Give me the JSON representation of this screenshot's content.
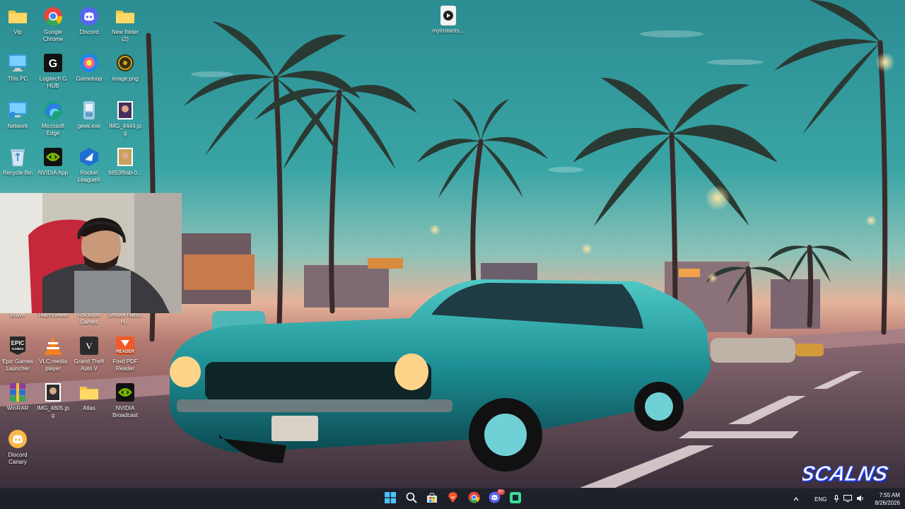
{
  "desktop": {
    "top_file": {
      "label": "myinstants...",
      "icon": "media-file-icon"
    },
    "icons": [
      {
        "id": "vip",
        "label": "Vip",
        "icon": "folder-icon",
        "color": "#f5c542"
      },
      {
        "id": "chrome",
        "label": "Google Chrome",
        "icon": "chrome-icon",
        "color": "#e8453c"
      },
      {
        "id": "discord",
        "label": "Discord",
        "icon": "discord-icon",
        "color": "#5865f2"
      },
      {
        "id": "new-folder",
        "label": "New folder (2)",
        "icon": "folder-icon",
        "color": "#f5c542"
      },
      {
        "id": "this-pc",
        "label": "This PC",
        "icon": "monitor-icon",
        "color": "#3aa0e8"
      },
      {
        "id": "logitech",
        "label": "Logitech G HUB",
        "icon": "logitech-icon",
        "color": "#111111"
      },
      {
        "id": "gameloop",
        "label": "Gameloop",
        "icon": "gameloop-icon",
        "color": "#1e88e5"
      },
      {
        "id": "image-png",
        "label": "image.png",
        "icon": "image-file-icon",
        "color": "#c9a227"
      },
      {
        "id": "network",
        "label": "Network",
        "icon": "network-icon",
        "color": "#3aa0e8"
      },
      {
        "id": "edge",
        "label": "Microsoft Edge",
        "icon": "edge-icon",
        "color": "#1aa37a"
      },
      {
        "id": "geek",
        "label": "geek.exe",
        "icon": "geek-icon",
        "color": "#7ab4d8"
      },
      {
        "id": "img4444",
        "label": "IMG_4444.jpg",
        "icon": "photo-thumbnail-icon",
        "color": "#4a2f5e"
      },
      {
        "id": "recycle",
        "label": "Recycle Bin",
        "icon": "recycle-bin-icon",
        "color": "#9fc7e0"
      },
      {
        "id": "nvidia-app",
        "label": "NVIDIA App",
        "icon": "nvidia-icon",
        "color": "#76b900"
      },
      {
        "id": "rocket",
        "label": "Rocket League®",
        "icon": "rocket-league-icon",
        "color": "#1f6fd1"
      },
      {
        "id": "b853",
        "label": "b853f6ab-0...",
        "icon": "photo-thumbnail-icon",
        "color": "#c6a15b"
      },
      {
        "id": "brave",
        "label": "Brave",
        "icon": "brave-icon",
        "color": "#fb542b"
      },
      {
        "id": "teamviewer",
        "label": "TeamViewer",
        "icon": "teamviewer-icon",
        "color": "#0e8ee9"
      },
      {
        "id": "rockstar",
        "label": "Rockstar Games",
        "icon": "rockstar-icon",
        "color": "#f4a900"
      },
      {
        "id": "smoke",
        "label": "Smoke Hand-H...",
        "icon": "photo-thumbnail-icon",
        "color": "#555555"
      },
      {
        "id": "epic",
        "label": "Epic Games Launcher",
        "icon": "epic-games-icon",
        "color": "#2a2a2a"
      },
      {
        "id": "vlc",
        "label": "VLC media player",
        "icon": "vlc-icon",
        "color": "#f58220"
      },
      {
        "id": "gta",
        "label": "Grand Theft Auto V",
        "icon": "gta-icon",
        "color": "#2b2b2b"
      },
      {
        "id": "foxit",
        "label": "Foxit PDF Reader",
        "icon": "foxit-icon",
        "color": "#f05a28"
      },
      {
        "id": "winrar",
        "label": "WinRAR",
        "icon": "winrar-icon",
        "color": "#8e3b9c"
      },
      {
        "id": "img4805",
        "label": "IMG_4805.jpg",
        "icon": "photo-thumbnail-icon",
        "color": "#2d2d2d"
      },
      {
        "id": "atlas",
        "label": "Atlas",
        "icon": "folder-icon",
        "color": "#f5c542"
      },
      {
        "id": "nvidia-broadcast",
        "label": "NVIDIA Broadcast",
        "icon": "nvidia-icon",
        "color": "#76b900"
      },
      {
        "id": "discord-canary",
        "label": "Discord Canary",
        "icon": "discord-canary-icon",
        "color": "#fbb848"
      }
    ]
  },
  "taskbar": {
    "pinned": [
      {
        "id": "start",
        "icon": "windows-start-icon",
        "color": "#4cc2ff"
      },
      {
        "id": "search",
        "icon": "search-icon",
        "color": "#ffffff"
      },
      {
        "id": "store",
        "icon": "store-icon",
        "color": "#e0e0e0"
      },
      {
        "id": "brave",
        "icon": "brave-icon",
        "color": "#fb542b"
      },
      {
        "id": "chrome",
        "icon": "chrome-icon",
        "color": "#e8453c"
      },
      {
        "id": "discord",
        "icon": "discord-icon",
        "color": "#5865f2",
        "badge": "9+"
      },
      {
        "id": "app",
        "icon": "app-icon",
        "color": "#3ddc97"
      }
    ],
    "tray": {
      "language": "ENG",
      "time": "7:55 AM",
      "date": "8/26/2026"
    }
  },
  "watermark": {
    "text": "SCALNS"
  }
}
